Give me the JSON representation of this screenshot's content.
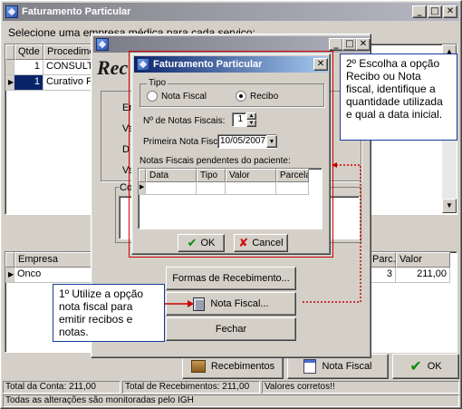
{
  "main_window": {
    "title": "Faturamento Particular",
    "subtitle": "Selecione uma empresa médica para cada serviço:",
    "grid_headers": [
      "Qtde",
      "Procedimen"
    ],
    "grid_rows": [
      {
        "qtde": "1",
        "proc": "CONSULTA"
      },
      {
        "qtde": "1",
        "proc": "Curativo Pe"
      }
    ],
    "bottom_grid_header": "Empresa",
    "bottom_grid_row": "Onco",
    "parc_header": "Parc.",
    "valor_header": "Valor",
    "parc_value": "3",
    "valor_value": "211,00",
    "btn_recebimentos": "Recebimentos",
    "btn_nota_fiscal": "Nota Fiscal",
    "btn_ok": "OK",
    "status": {
      "total_conta": "Total da Conta: 211,00",
      "total_recebimentos": "Total de Recebimentos: 211,00",
      "valores": "Valores corretos!!",
      "monitor": "Todas as alterações são monitoradas pelo IGH"
    }
  },
  "receb_window": {
    "title_partial": "Rec",
    "labels": [
      "Er",
      "Va",
      "D",
      "Va"
    ],
    "group_label": "Co",
    "btn_formas": "Formas de Recebimento...",
    "btn_nota": "Nota Fiscal...",
    "btn_fechar": "Fechar"
  },
  "dialog": {
    "title": "Faturamento Particular",
    "tipo_label": "Tipo",
    "radio_nota": "Nota Fiscal",
    "radio_recibo": "Recibo",
    "selected": "Recibo",
    "num_notas_label": "Nº de Notas Fiscais:",
    "num_notas_value": "1",
    "primeira_label": "Primeira Nota Fiscal:",
    "primeira_value": "10/05/2007",
    "pendentes_label": "Notas Fiscais pendentes do paciente:",
    "columns": [
      "Data",
      "Tipo",
      "Valor",
      "Parcela"
    ],
    "btn_ok": "OK",
    "btn_cancel": "Cancel"
  },
  "annotations": {
    "note1": "1º Utilize a opção nota fiscal para emitir recibos e notas.",
    "note2": "2º Escolha a opção Recibo ou Nota fiscal, identifique a quantidade utilizada e qual a data inicial."
  },
  "colors": {
    "title_active_start": "#0a246a",
    "title_active_end": "#a6caf0",
    "title_inactive": "#8a8a96",
    "highlight_row": "#0a246a",
    "callout_border": "#cc0000",
    "note_border": "#1a3a9a"
  }
}
